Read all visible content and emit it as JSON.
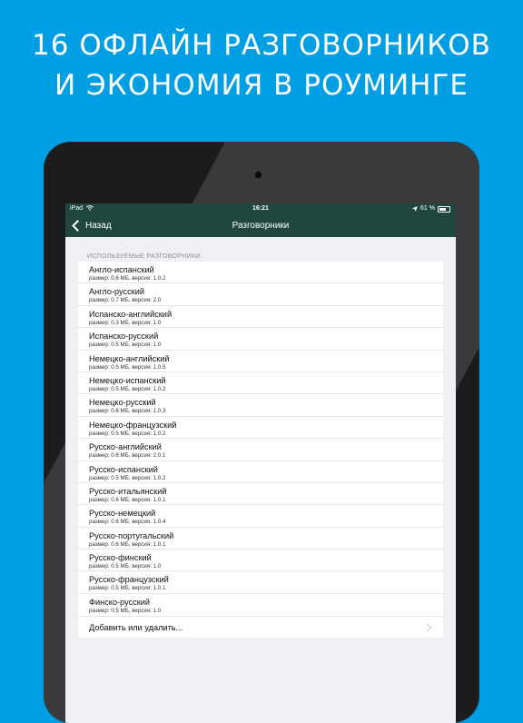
{
  "headline": {
    "line1": "16  ОФЛАЙН РАЗГОВОРНИКОВ",
    "line2": "И ЭКОНОМИЯ В  РОУМИНГЕ"
  },
  "statusbar": {
    "carrier": "iPad",
    "time": "16:21",
    "battery": "61 %"
  },
  "navbar": {
    "back_label": "Назад",
    "title": "Разговорники"
  },
  "section": {
    "header": "ИСПОЛЬЗУЕМЫЕ РАЗГОВОРНИКИ"
  },
  "phrasebooks": [
    {
      "title": "Англо-испанский",
      "sub": "размер: 0.6 МБ, версия: 1.0.2"
    },
    {
      "title": "Англо-русский",
      "sub": "размер: 0.7 МБ, версия: 2.0"
    },
    {
      "title": "Испанско-английский",
      "sub": "размер: 0.3 МБ, версия: 1.0"
    },
    {
      "title": "Испанско-русский",
      "sub": "размер: 0.5 МБ, версия: 1.0"
    },
    {
      "title": "Немецко-английский",
      "sub": "размер: 0.5 МБ, версия: 1.0.5"
    },
    {
      "title": "Немецко-испанский",
      "sub": "размер: 0.5 МБ, версия: 1.0.2"
    },
    {
      "title": "Немецко-русский",
      "sub": "размер: 0.6 МБ, версия: 1.0.3"
    },
    {
      "title": "Немецко-французский",
      "sub": "размер: 0.5 МБ, версия: 1.0.2"
    },
    {
      "title": "Русско-английский",
      "sub": "размер: 0.6 МБ, версия: 2.0.1"
    },
    {
      "title": "Русско-испанский",
      "sub": "размер: 0.5 МБ, версия: 1.0.2"
    },
    {
      "title": "Русско-итальянский",
      "sub": "размер: 0.6 МБ, версия: 1.0.1"
    },
    {
      "title": "Русско-немецкий",
      "sub": "размер: 0.6 МБ, версия: 1.0.4"
    },
    {
      "title": "Русско-португальский",
      "sub": "размер: 0.6 МБ, версия: 1.0.1"
    },
    {
      "title": "Русско-финский",
      "sub": "размер: 0.5 МБ, версия: 1.0"
    },
    {
      "title": "Русско-французский",
      "sub": "размер: 0.5 МБ, версия: 1.0.1"
    },
    {
      "title": "Финско-русский",
      "sub": "размер: 0.5 МБ, версия: 1.0"
    }
  ],
  "action": {
    "label": "Добавить или удалить..."
  },
  "colors": {
    "background": "#009fe3",
    "navbar": "#1f4740",
    "device": "#1c1c1e"
  },
  "icons": {
    "wifi": "wifi-icon",
    "location": "location-arrow-icon",
    "battery": "battery-icon",
    "back": "chevron-left-icon",
    "disclosure": "chevron-right-icon"
  }
}
